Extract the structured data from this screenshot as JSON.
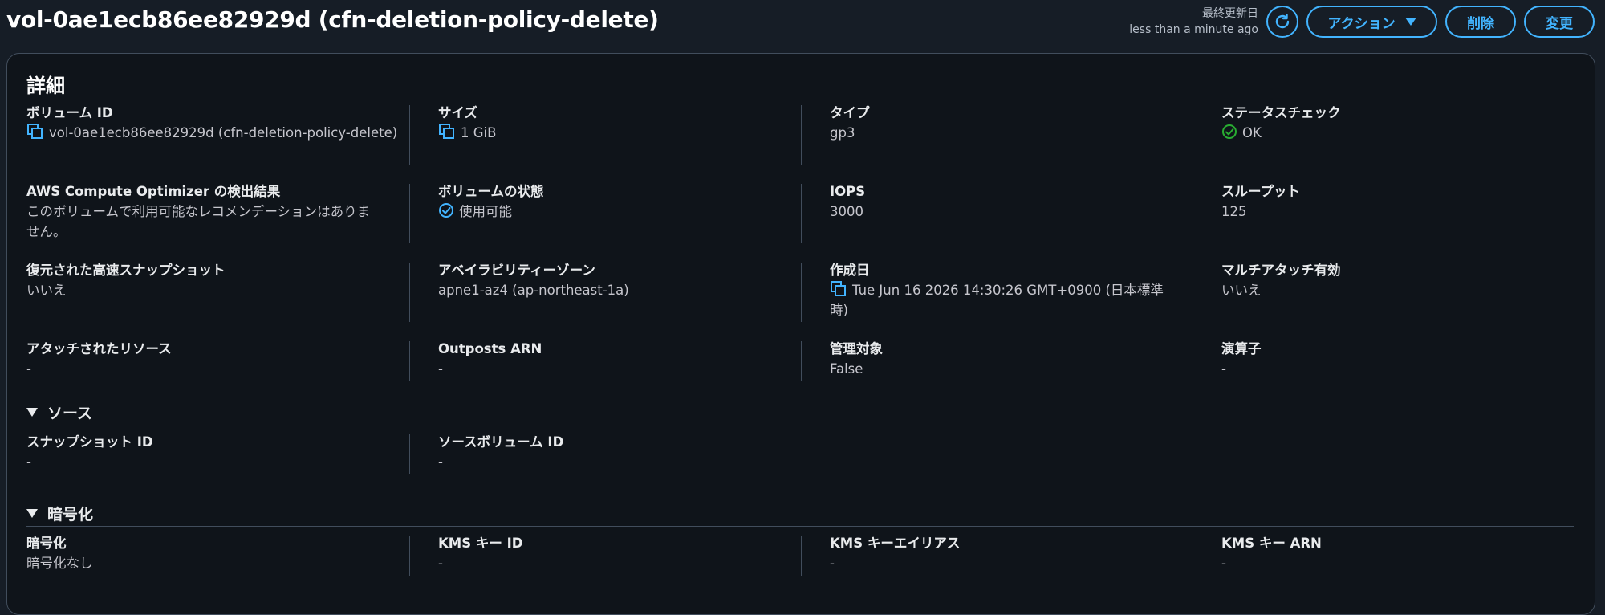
{
  "header": {
    "title": "vol-0ae1ecb86ee82929d (cfn-deletion-policy-delete)",
    "updated_label": "最終更新日",
    "updated_value": "less than a minute ago",
    "actions_label": "アクション",
    "delete_label": "削除",
    "modify_label": "変更",
    "accent": "#42b4ff"
  },
  "details": {
    "title": "詳細",
    "volume_id": {
      "label": "ボリューム ID",
      "value": "vol-0ae1ecb86ee82929d (cfn-deletion-policy-delete)"
    },
    "size": {
      "label": "サイズ",
      "value": "1 GiB"
    },
    "type": {
      "label": "タイプ",
      "value": "gp3"
    },
    "status_check": {
      "label": "ステータスチェック",
      "value": "OK"
    },
    "optimizer": {
      "label": "AWS Compute Optimizer の検出結果",
      "value": "このボリュームで利用可能なレコメンデーションはありません。"
    },
    "volume_state": {
      "label": "ボリュームの状態",
      "value": "使用可能"
    },
    "iops": {
      "label": "IOPS",
      "value": "3000"
    },
    "throughput": {
      "label": "スループット",
      "value": "125"
    },
    "fast_snapshot": {
      "label": "復元された高速スナップショット",
      "value": "いいえ"
    },
    "az": {
      "label": "アベイラビリティーゾーン",
      "value": "apne1-az4 (ap-northeast-1a)"
    },
    "created": {
      "label": "作成日",
      "value": "Tue Jun 16 2026 14:30:26 GMT+0900 (日本標準時)"
    },
    "multi_attach": {
      "label": "マルチアタッチ有効",
      "value": "いいえ"
    },
    "attached": {
      "label": "アタッチされたリソース",
      "value": "-"
    },
    "outposts": {
      "label": "Outposts ARN",
      "value": "-"
    },
    "managed": {
      "label": "管理対象",
      "value": "False"
    },
    "operator": {
      "label": "演算子",
      "value": "-"
    }
  },
  "source": {
    "title": "ソース",
    "snapshot_id": {
      "label": "スナップショット ID",
      "value": "-"
    },
    "source_volume_id": {
      "label": "ソースボリューム ID",
      "value": "-"
    }
  },
  "encryption": {
    "title": "暗号化",
    "encryption": {
      "label": "暗号化",
      "value": "暗号化なし"
    },
    "kms_id": {
      "label": "KMS キー ID",
      "value": "-"
    },
    "kms_alias": {
      "label": "KMS キーエイリアス",
      "value": "-"
    },
    "kms_arn": {
      "label": "KMS キー ARN",
      "value": "-"
    }
  },
  "colors": {
    "background": "#161d26",
    "panel": "#0f141a",
    "link": "#42b4ff",
    "success": "#29ad32",
    "divider": "#414d5c"
  }
}
